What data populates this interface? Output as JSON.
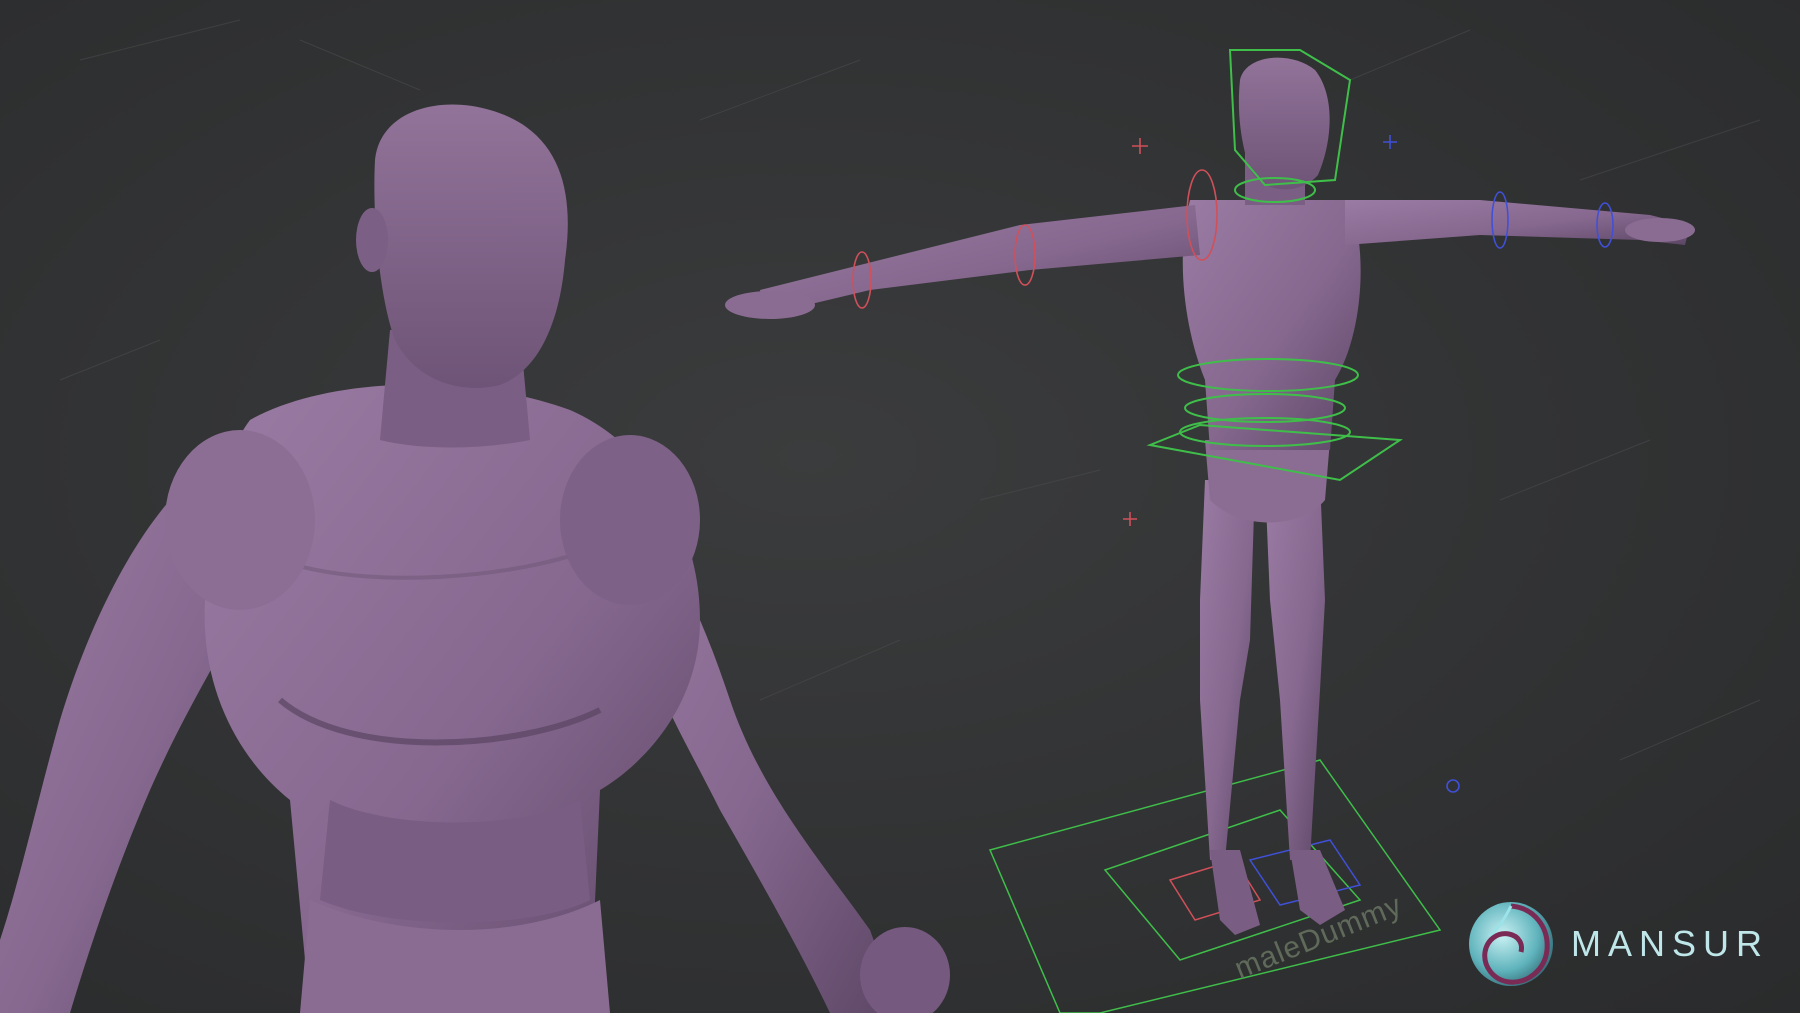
{
  "scene": {
    "rig_label": "maleDummy",
    "brand": {
      "name": "MANSUR",
      "logo_icon": "spiral-shell-logo"
    },
    "colors": {
      "background": "#323334",
      "mesh": "#86688f",
      "mesh_shadow": "#5e4866",
      "control_green": "#3fbf4a",
      "control_red": "#d0505a",
      "control_blue": "#4050d8",
      "brand": "#bfe7ea"
    }
  }
}
